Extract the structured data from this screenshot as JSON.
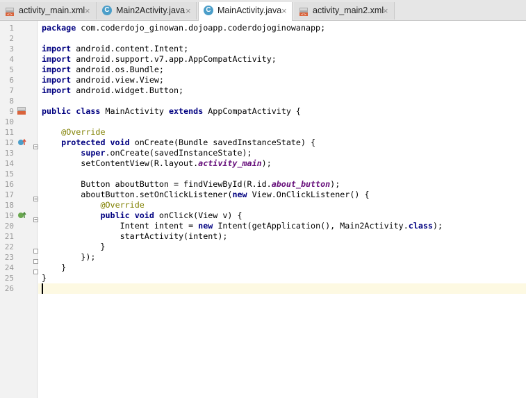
{
  "tabs": [
    {
      "label": "activity_main.xml",
      "type": "xml",
      "active": false
    },
    {
      "label": "Main2Activity.java",
      "type": "java",
      "active": false
    },
    {
      "label": "MainActivity.java",
      "type": "java",
      "active": true
    },
    {
      "label": "activity_main2.xml",
      "type": "xml",
      "active": false
    }
  ],
  "java_icon_letter": "C",
  "close_glyph": "×",
  "editor": {
    "current_line": 26,
    "lines": [
      {
        "n": "1",
        "tokens": [
          {
            "t": "package",
            "c": "kw"
          },
          {
            "t": " com.coderdojo_ginowan.dojoapp.coderdojoginowanapp;"
          }
        ]
      },
      {
        "n": "2",
        "tokens": []
      },
      {
        "n": "3",
        "tokens": [
          {
            "t": "import",
            "c": "kw"
          },
          {
            "t": " android.content.Intent;"
          }
        ]
      },
      {
        "n": "4",
        "tokens": [
          {
            "t": "import",
            "c": "kw"
          },
          {
            "t": " android.support.v7.app.AppCompatActivity;"
          }
        ]
      },
      {
        "n": "5",
        "tokens": [
          {
            "t": "import",
            "c": "kw"
          },
          {
            "t": " android.os.Bundle;"
          }
        ]
      },
      {
        "n": "6",
        "tokens": [
          {
            "t": "import",
            "c": "kw"
          },
          {
            "t": " android.view.View;"
          }
        ]
      },
      {
        "n": "7",
        "tokens": [
          {
            "t": "import",
            "c": "kw"
          },
          {
            "t": " android.widget.Button;"
          }
        ]
      },
      {
        "n": "8",
        "tokens": []
      },
      {
        "n": "9",
        "tokens": [
          {
            "t": "public class",
            "c": "kw"
          },
          {
            "t": " MainActivity "
          },
          {
            "t": "extends",
            "c": "kw"
          },
          {
            "t": " AppCompatActivity {"
          }
        ]
      },
      {
        "n": "10",
        "tokens": []
      },
      {
        "n": "11",
        "tokens": [
          {
            "t": "    "
          },
          {
            "t": "@Override",
            "c": "ann"
          }
        ]
      },
      {
        "n": "12",
        "tokens": [
          {
            "t": "    "
          },
          {
            "t": "protected void",
            "c": "kw"
          },
          {
            "t": " onCreate(Bundle savedInstanceState) {"
          }
        ]
      },
      {
        "n": "13",
        "tokens": [
          {
            "t": "        "
          },
          {
            "t": "super",
            "c": "kw"
          },
          {
            "t": ".onCreate(savedInstanceState);"
          }
        ]
      },
      {
        "n": "14",
        "tokens": [
          {
            "t": "        setContentView(R.layout."
          },
          {
            "t": "activity_main",
            "c": "fld"
          },
          {
            "t": ");"
          }
        ]
      },
      {
        "n": "15",
        "tokens": []
      },
      {
        "n": "16",
        "tokens": [
          {
            "t": "        Button aboutButton = findViewById(R.id."
          },
          {
            "t": "about_button",
            "c": "fld"
          },
          {
            "t": ");"
          }
        ]
      },
      {
        "n": "17",
        "tokens": [
          {
            "t": "        aboutButton.setOnClickListener("
          },
          {
            "t": "new",
            "c": "kw"
          },
          {
            "t": " View.OnClickListener() {"
          }
        ]
      },
      {
        "n": "18",
        "tokens": [
          {
            "t": "            "
          },
          {
            "t": "@Override",
            "c": "ann"
          }
        ]
      },
      {
        "n": "19",
        "tokens": [
          {
            "t": "            "
          },
          {
            "t": "public void",
            "c": "kw"
          },
          {
            "t": " onClick(View v) {"
          }
        ]
      },
      {
        "n": "20",
        "tokens": [
          {
            "t": "                Intent intent = "
          },
          {
            "t": "new",
            "c": "kw"
          },
          {
            "t": " Intent(getApplication(), Main2Activity."
          },
          {
            "t": "class",
            "c": "kw"
          },
          {
            "t": ");"
          }
        ]
      },
      {
        "n": "21",
        "tokens": [
          {
            "t": "                startActivity(intent);"
          }
        ]
      },
      {
        "n": "22",
        "tokens": [
          {
            "t": "            }"
          }
        ]
      },
      {
        "n": "23",
        "tokens": [
          {
            "t": "        });"
          }
        ]
      },
      {
        "n": "24",
        "tokens": [
          {
            "t": "    }"
          }
        ]
      },
      {
        "n": "25",
        "tokens": [
          {
            "t": "}"
          }
        ]
      },
      {
        "n": "26",
        "tokens": []
      }
    ]
  },
  "colors": {
    "keyword": "#000080",
    "annotation": "#808000",
    "field": "#660e7a",
    "current_line_bg": "#fdf9e2",
    "gutter_bg": "#f2f2f2"
  }
}
